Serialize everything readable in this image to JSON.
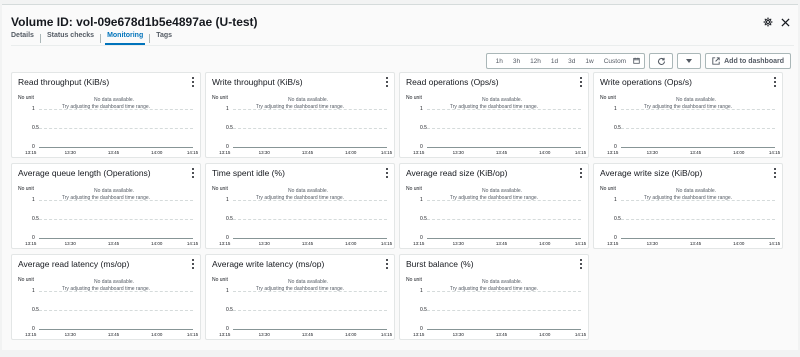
{
  "header": {
    "title": "Volume ID: vol-09e678d1b5e4897ae (U-test)"
  },
  "tabs": [
    {
      "label": "Details",
      "active": false
    },
    {
      "label": "Status checks",
      "active": false
    },
    {
      "label": "Monitoring",
      "active": true
    },
    {
      "label": "Tags",
      "active": false
    }
  ],
  "toolbar": {
    "ranges": [
      "1h",
      "3h",
      "12h",
      "1d",
      "3d",
      "1w",
      "Custom"
    ],
    "add_dashboard_label": "Add to dashboard"
  },
  "widgets": {
    "unit_label": "No unit",
    "empty_line1": "No data available.",
    "empty_line2": "Try adjusting the dashboard time range.",
    "y_ticks": [
      "1",
      "0.5",
      "0"
    ],
    "x_ticks": [
      "13:15",
      "13:30",
      "13:45",
      "14:00",
      "14:15"
    ],
    "titles": [
      "Read throughput (KiB/s)",
      "Write throughput (KiB/s)",
      "Read operations (Ops/s)",
      "Write operations (Ops/s)",
      "Average queue length (Operations)",
      "Time spent idle (%)",
      "Average read size (KiB/op)",
      "Average write size (KiB/op)",
      "Average read latency (ms/op)",
      "Average write latency (ms/op)",
      "Burst balance (%)"
    ]
  },
  "colors": {
    "accent": "#0073bb",
    "text": "#16191f",
    "muted": "#545b64"
  }
}
